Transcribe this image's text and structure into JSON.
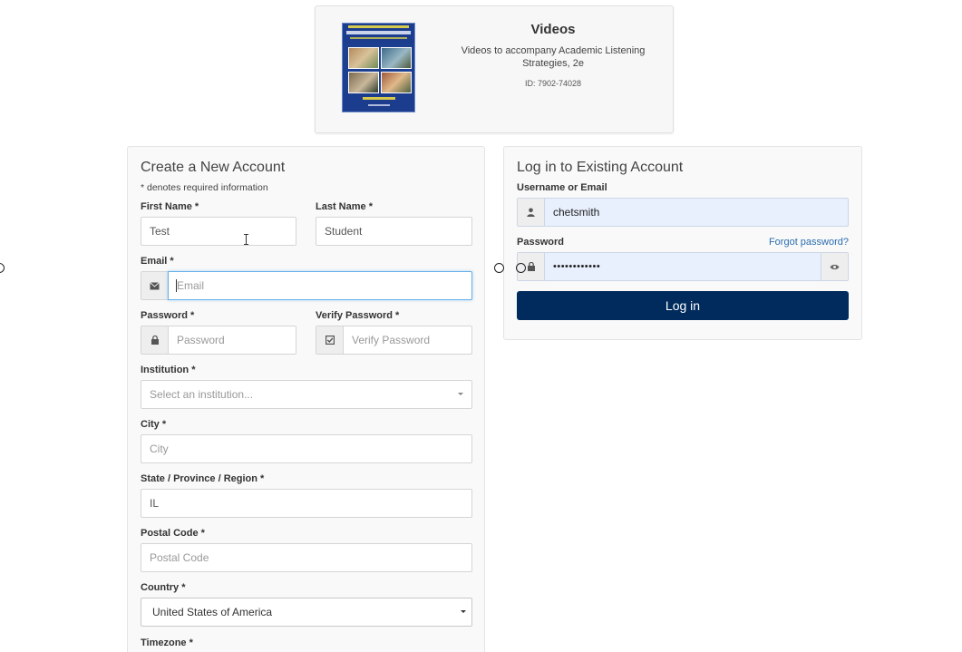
{
  "product": {
    "title": "Videos",
    "description": "Videos to accompany Academic Listening Strategies, 2e",
    "id_text": "ID: 7902-74028",
    "cover_alt": "book-cover",
    "cover_text": {
      "edition": "2ND EDITION",
      "title": "Academic Listening Strategies",
      "subtitle": "A GUIDE TO UNIVERSITY LECTURES",
      "author": "Julia Salehzadeh"
    }
  },
  "create_account": {
    "heading": "Create a New Account",
    "required_note": "* denotes required information",
    "first_name": {
      "label": "First Name *",
      "value": "Test",
      "placeholder": "First Name"
    },
    "last_name": {
      "label": "Last Name *",
      "value": "Student",
      "placeholder": "Last Name"
    },
    "email": {
      "label": "Email *",
      "value": "",
      "placeholder": "Email",
      "icon": "envelope-icon"
    },
    "password": {
      "label": "Password *",
      "value": "",
      "placeholder": "Password",
      "icon": "lock-icon"
    },
    "verify_password": {
      "label": "Verify Password *",
      "value": "",
      "placeholder": "Verify Password",
      "icon": "check-square-icon"
    },
    "institution": {
      "label": "Institution *",
      "placeholder": "Select an institution..."
    },
    "city": {
      "label": "City *",
      "value": "",
      "placeholder": "City"
    },
    "state": {
      "label": "State / Province / Region *",
      "value": "IL"
    },
    "postal_code": {
      "label": "Postal Code *",
      "value": "",
      "placeholder": "Postal Code"
    },
    "country": {
      "label": "Country *",
      "selected": "United States of America"
    },
    "timezone": {
      "label": "Timezone *"
    }
  },
  "login": {
    "heading": "Log in to Existing Account",
    "username": {
      "label": "Username or Email",
      "value": "chetsmith",
      "icon": "user-icon"
    },
    "password": {
      "label": "Password",
      "masked_value": "••••••••••••",
      "icon": "lock-icon",
      "toggle_icon": "eye-icon"
    },
    "forgot_link": "Forgot password?",
    "submit_label": "Log in"
  },
  "colors": {
    "primary_button": "#002b5c",
    "link": "#2a6db0",
    "focus_border": "#66afe9",
    "autofill_bg": "#e8f0fe",
    "panel_bg": "#f9f9f9"
  }
}
